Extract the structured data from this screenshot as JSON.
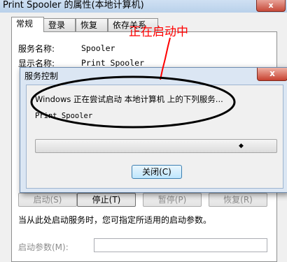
{
  "properties_window": {
    "title": "Print Spooler 的属性(本地计算机)",
    "close_glyph": "x",
    "tabs": [
      "常规",
      "登录",
      "恢复",
      "依存关系"
    ],
    "service_name_label": "服务名称:",
    "service_name_value": "Spooler",
    "display_name_label": "显示名称:",
    "display_name_value": "Print Spooler",
    "buttons": {
      "start": "启动(S)",
      "stop": "停止(T)",
      "pause": "暂停(P)",
      "resume": "恢复(R)"
    },
    "start_params_hint": "当从此处启动服务时，您可指定所适用的启动参数。",
    "start_params_label": "启动参数(M):",
    "start_params_value": ""
  },
  "service_dialog": {
    "title": "服务控制",
    "close_glyph": "x",
    "message": "Windows 正在尝试启动 本地计算机 上的下列服务...",
    "service": "Print Spooler",
    "progress": 0.0,
    "close_button": "关闭(C)"
  },
  "annotation": {
    "text": "正在启动中",
    "color": "#ff0000"
  }
}
